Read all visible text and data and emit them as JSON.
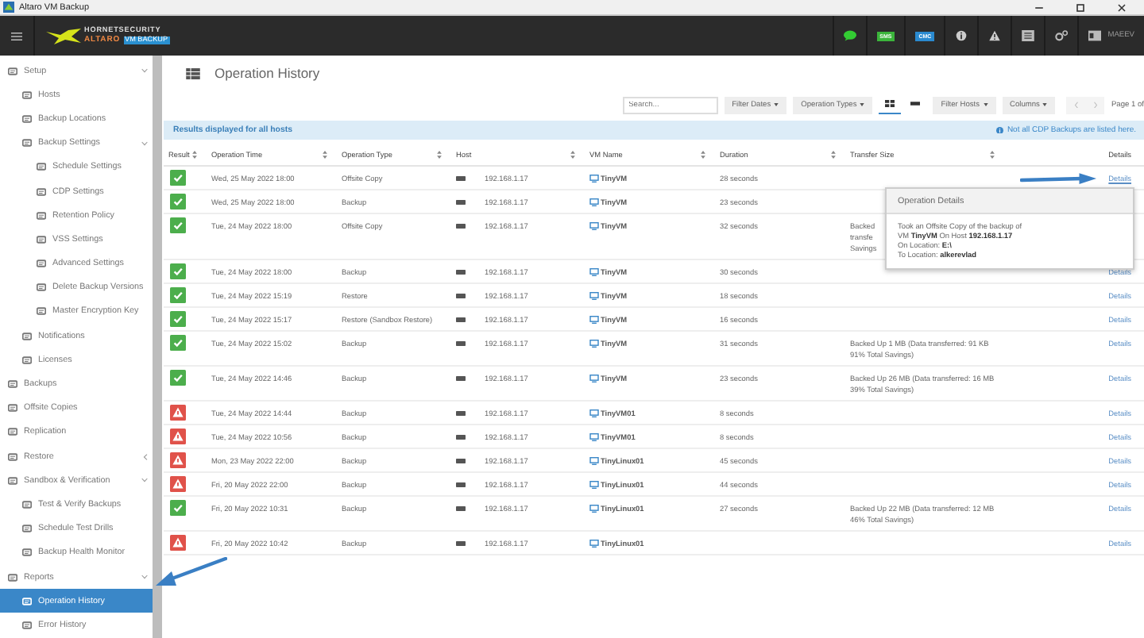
{
  "window": {
    "title": "Altaro VM Backup"
  },
  "header": {
    "logo": {
      "brand": "HORNETSECURITY",
      "product": "ALTARO",
      "badge": "VM BACKUP"
    },
    "badges": [
      "SMS",
      "CMC"
    ],
    "user": "MAEEV"
  },
  "sidebar": {
    "items": [
      {
        "label": "Setup",
        "selected": false,
        "expanded": true,
        "children": [
          {
            "label": "Hosts",
            "selected": false
          },
          {
            "label": "Backup Locations",
            "selected": false
          },
          {
            "label": "Backup Settings",
            "selected": false,
            "expanded": true,
            "children": [
              {
                "label": "Schedule Settings",
                "selected": false
              },
              {
                "label": "CDP Settings",
                "selected": false
              },
              {
                "label": "Retention Policy",
                "selected": false
              },
              {
                "label": "VSS Settings",
                "selected": false
              },
              {
                "label": "Advanced Settings",
                "selected": false
              },
              {
                "label": "Delete Backup Versions",
                "selected": false
              },
              {
                "label": "Master Encryption Key",
                "selected": false
              }
            ]
          },
          {
            "label": "Notifications",
            "selected": false
          },
          {
            "label": "Licenses",
            "selected": false
          }
        ]
      },
      {
        "label": "Backups",
        "selected": false
      },
      {
        "label": "Offsite Copies",
        "selected": false
      },
      {
        "label": "Replication",
        "selected": false
      },
      {
        "label": "Restore",
        "selected": false,
        "expanded": false
      },
      {
        "label": "Sandbox & Verification",
        "selected": false,
        "expanded": true,
        "children": [
          {
            "label": "Test & Verify Backups",
            "selected": false
          },
          {
            "label": "Schedule Test Drills",
            "selected": false
          },
          {
            "label": "Backup Health Monitor",
            "selected": false
          }
        ]
      },
      {
        "label": "Reports",
        "selected": false,
        "expanded": true,
        "children": [
          {
            "label": "Operation History",
            "selected": true
          },
          {
            "label": "Error History",
            "selected": false
          }
        ]
      }
    ]
  },
  "page": {
    "title": "Operation History"
  },
  "toolbar": {
    "search": {
      "placeholder": "Search..."
    },
    "filters": [
      "Filter Dates",
      "Operation Types"
    ],
    "view_toggle": [
      {
        "selected": true
      },
      {
        "selected": false
      }
    ],
    "filters_2": [
      "Filter Hosts",
      "Columns"
    ],
    "pager": "Page 1 of"
  },
  "info_bar": {
    "text": "Results displayed for all hosts",
    "note": "Not all CDP Backups are listed here."
  },
  "table": {
    "columns": [
      {
        "label": "Result",
        "sortable": true
      },
      {
        "label": "Operation Time",
        "sortable": true
      },
      {
        "label": "Operation Type",
        "sortable": true
      },
      {
        "label": "Host",
        "sortable": true
      },
      {
        "label": "VM Name",
        "sortable": true
      },
      {
        "label": "Duration",
        "sortable": true
      },
      {
        "label": "Transfer Size",
        "sortable": true
      },
      {
        "label": "Details",
        "sortable": false
      }
    ],
    "rows": [
      {
        "kind": "success",
        "time": "Wed, 25 May 2022 18:00",
        "type": "Offsite Copy",
        "host": "192.168.1.17",
        "vm": "TinyVM",
        "duration": "28 seconds",
        "details": "Details"
      },
      {
        "kind": "success",
        "time": "Wed, 25 May 2022 18:00",
        "type": "Backup",
        "host": "192.168.1.17",
        "vm": "TinyVM",
        "duration": "23 seconds"
      },
      {
        "kind": "success",
        "time": "Tue, 24 May 2022 18:00",
        "type": "Offsite Copy",
        "host": "192.168.1.17",
        "vm": "TinyVM",
        "duration": "32 seconds",
        "transfer_lines": [
          "Backed",
          "transfe",
          "Savings"
        ]
      },
      {
        "kind": "success",
        "time": "Tue, 24 May 2022 18:00",
        "type": "Backup",
        "host": "192.168.1.17",
        "vm": "TinyVM",
        "duration": "30 seconds",
        "details": "Details"
      },
      {
        "kind": "success",
        "time": "Tue, 24 May 2022 15:19",
        "type": "Restore",
        "host": "192.168.1.17",
        "vm": "TinyVM",
        "duration": "18 seconds",
        "details": "Details"
      },
      {
        "kind": "success",
        "time": "Tue, 24 May 2022 15:17",
        "type": "Restore (Sandbox Restore)",
        "host": "192.168.1.17",
        "vm": "TinyVM",
        "duration": "16 seconds",
        "details": "Details"
      },
      {
        "kind": "success",
        "time": "Tue, 24 May 2022 15:02",
        "type": "Backup",
        "host": "192.168.1.17",
        "vm": "TinyVM",
        "duration": "31 seconds",
        "transfer": "Backed Up 1 MB (Data transferred: 91 KB 91% Total Savings)",
        "details": "Details"
      },
      {
        "kind": "success",
        "time": "Tue, 24 May 2022 14:46",
        "type": "Backup",
        "host": "192.168.1.17",
        "vm": "TinyVM",
        "duration": "23 seconds",
        "transfer": "Backed Up 26 MB (Data transferred: 16 MB 39% Total Savings)",
        "details": "Details"
      },
      {
        "kind": "warning",
        "time": "Tue, 24 May 2022 14:44",
        "type": "Backup",
        "host": "192.168.1.17",
        "vm": "TinyVM01",
        "duration": "8 seconds",
        "details": "Details"
      },
      {
        "kind": "warning",
        "time": "Tue, 24 May 2022 10:56",
        "type": "Backup",
        "host": "192.168.1.17",
        "vm": "TinyVM01",
        "duration": "8 seconds",
        "details": "Details"
      },
      {
        "kind": "warning",
        "time": "Mon, 23 May 2022 22:00",
        "type": "Backup",
        "host": "192.168.1.17",
        "vm": "TinyLinux01",
        "duration": "45 seconds",
        "details": "Details"
      },
      {
        "kind": "warning",
        "time": "Fri, 20 May 2022 22:00",
        "type": "Backup",
        "host": "192.168.1.17",
        "vm": "TinyLinux01",
        "duration": "44 seconds",
        "details": "Details"
      },
      {
        "kind": "success",
        "time": "Fri, 20 May 2022 10:31",
        "type": "Backup",
        "host": "192.168.1.17",
        "vm": "TinyLinux01",
        "duration": "27 seconds",
        "transfer": "Backed Up 22 MB (Data transferred: 12 MB 46% Total Savings)",
        "details": "Details"
      },
      {
        "kind": "warning",
        "time": "Fri, 20 May 2022 10:42",
        "type": "Backup",
        "host": "192.168.1.17",
        "vm": "TinyLinux01",
        "details": "Details"
      }
    ]
  },
  "popover": {
    "title": "Operation Details",
    "lines": [
      "Took an Offsite Copy of the backup of",
      "VM **TinyVM** On Host **192.168.1.17**",
      "On Location: **E:\\**",
      "To Location: **alkerevlad**"
    ]
  }
}
